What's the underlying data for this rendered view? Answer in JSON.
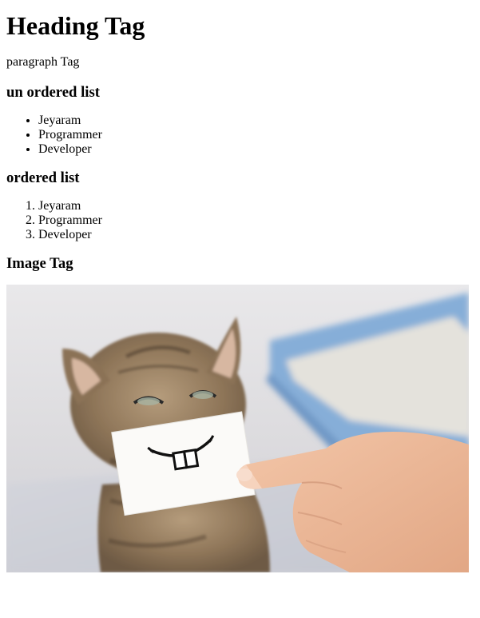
{
  "heading": "Heading Tag",
  "paragraph": "paragraph Tag",
  "unordered": {
    "title": "un ordered list",
    "items": [
      "Jeyaram",
      "Programmer",
      "Developer"
    ]
  },
  "ordered": {
    "title": "ordered list",
    "items": [
      "Jeyaram",
      "Programmer",
      "Developer"
    ]
  },
  "image_section": {
    "title": "Image Tag",
    "image_description_icon": "kitten-photo"
  }
}
